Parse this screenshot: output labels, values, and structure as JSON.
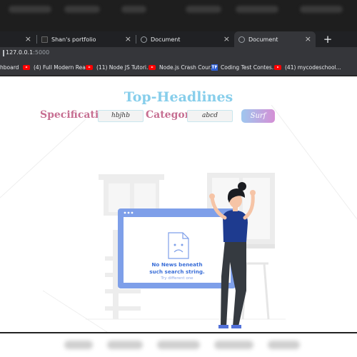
{
  "browser": {
    "tabs": [
      {
        "title": ""
      },
      {
        "title": "Shan's portfolio"
      },
      {
        "title": "Document"
      },
      {
        "title": "Document"
      }
    ],
    "new_tab_label": "+",
    "close_label": "×",
    "url_host": "127.0.0.1",
    "url_port": ":5000",
    "bookmarks": [
      {
        "label": "hboard"
      },
      {
        "label": "(4) Full Modern Rea..."
      },
      {
        "label": "(11) Node JS Tutori..."
      },
      {
        "label": "Node.js Crash Cour..."
      },
      {
        "label": "Coding Test Contes..."
      },
      {
        "label": "(41) mycodeschool..."
      }
    ],
    "bookmark_brand_glyph": "TF"
  },
  "page": {
    "title": "Top-Headlines",
    "specification_label": "Specification",
    "specification_value": "hbjhb",
    "category_label": "Category",
    "category_value": "abcd",
    "surf_label": "Surf",
    "empty_state": {
      "line1": "No News beneath",
      "line2": "such search string.",
      "hint": "Try different one"
    }
  },
  "colors": {
    "title": "#87ceeb",
    "labels": "#c76f92",
    "button_gradient_start": "#9ec7ef",
    "button_gradient_end": "#d58fd5",
    "empty_state_text": "#3b6fd8"
  }
}
